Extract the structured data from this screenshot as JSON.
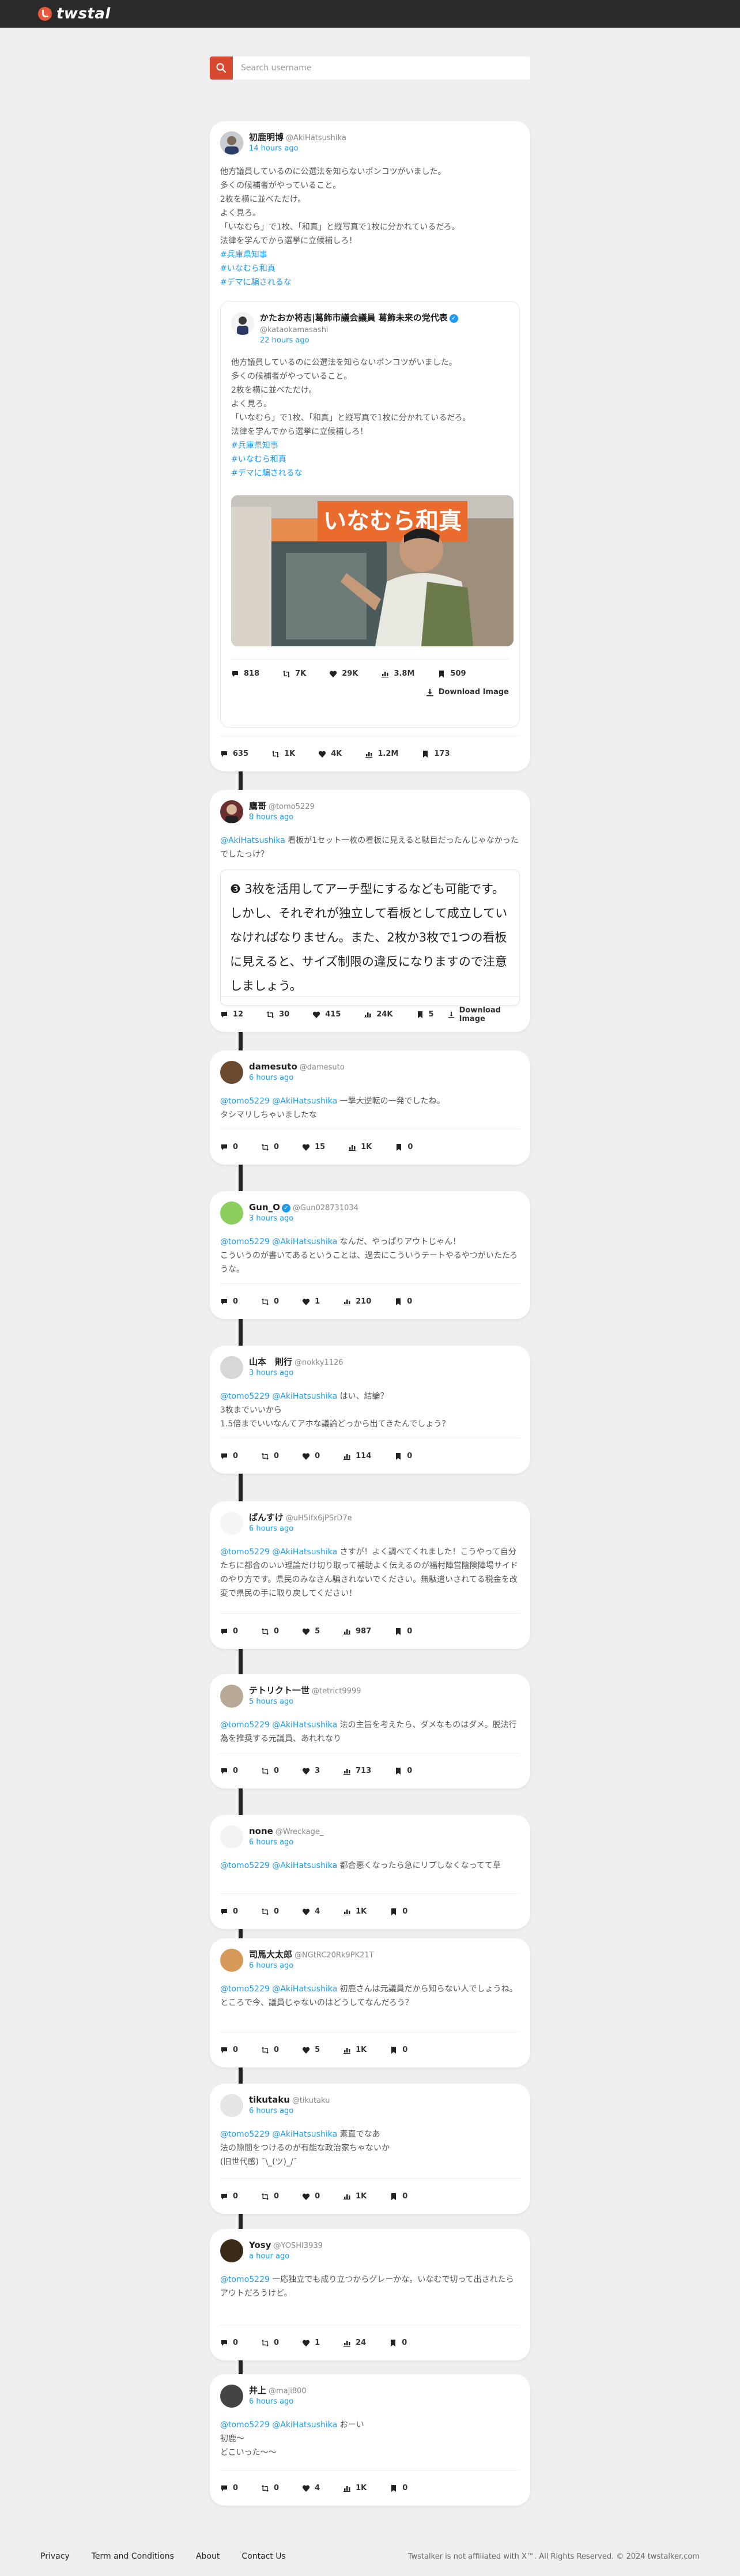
{
  "app": {
    "name": "twstal"
  },
  "search": {
    "placeholder": "Search username"
  },
  "main_post": {
    "display_name": "初鹿明博",
    "username": "@AkiHatsushika",
    "time": "14 hours ago",
    "text": "他方議員しているのに公選法を知らないポンコツがいました。\n多くの候補者がやっていること。\n2枚を横に並べただけ。\nよく見ろ。\n「いなむら」で1枚、「和真」と縦写真で1枚に分かれているだろ。\n法律を学んでから選挙に立候補しろ！",
    "hashtags": [
      "#兵庫県知事",
      "#いなむら和真",
      "#デマに騙されるな"
    ],
    "stats": {
      "replies": "635",
      "reposts": "1K",
      "likes": "4K",
      "views": "1.2M",
      "bookmarks": "173"
    },
    "quoted": {
      "display_name": "かたおか将志|葛飾市議会議員 葛飾未来の党代表",
      "username": "@kataokamasashi",
      "time": "22 hours ago",
      "text": "他方議員しているのに公選法を知らないポンコツがいました。\n多くの候補者がやっていること。\n2枚を横に並べただけ。\nよく見ろ。\n「いなむら」で1枚、「和真」と縦写真で1枚に分かれているだろ。\n法律を学んでから選挙に立候補しろ！",
      "hashtags": [
        "#兵庫県知事",
        "#いなむら和真",
        "#デマに騙されるな"
      ],
      "photo_sign_text": "いなむら和真",
      "stats": {
        "replies": "818",
        "reposts": "7K",
        "likes": "29K",
        "views": "3.8M",
        "bookmarks": "509"
      },
      "download_label": "Download Image"
    }
  },
  "replies": [
    {
      "display_name": "鷹哥",
      "username": "@tomo5229",
      "time": "8 hours ago",
      "mentions": "@AkiHatsushika",
      "text": " 看板が1セット一枚の看板に見えると駄目だったんじゃなかったでしたっけ？",
      "quote_text": "❸ 3枚を活用してアーチ型にするなども可能です。しかし、それぞれが独立して看板として成立していなければなりません。また、2枚か3枚で1つの看板に見えると、サイズ制限の違反になりますので注意しましょう。",
      "stats": {
        "replies": "12",
        "reposts": "30",
        "likes": "415",
        "views": "24K",
        "bookmarks": "5"
      },
      "download_label": "Download Image"
    },
    {
      "display_name": "damesuto",
      "username": "@damesuto",
      "time": "6 hours ago",
      "mentions": "@tomo5229 @AkiHatsushika",
      "text": " 一撃大逆転の一発でしたね。\nタシマリしちゃいましたな",
      "stats": {
        "replies": "0",
        "reposts": "0",
        "likes": "15",
        "views": "1K",
        "bookmarks": "0"
      }
    },
    {
      "display_name": "Gun_O",
      "username": "@Gun028731034",
      "time": "3 hours ago",
      "mentions": "@tomo5229 @AkiHatsushika",
      "text": " なんだ、やっぱりアウトじゃん！\nこういうのが書いてあるということは、過去にこういうテートやるやつがいたたろうな。",
      "stats": {
        "replies": "0",
        "reposts": "0",
        "likes": "1",
        "views": "210",
        "bookmarks": "0"
      }
    },
    {
      "display_name": "山本　則行",
      "username": "@nokky1126",
      "time": "3 hours ago",
      "mentions": "@tomo5229 @AkiHatsushika",
      "text": " はい、結論？\n3枚までいいから\n1.5倍までいいなんてアホな議論どっから出てきたんでしょう？",
      "stats": {
        "replies": "0",
        "reposts": "0",
        "likes": "0",
        "views": "114",
        "bookmarks": "0"
      }
    },
    {
      "display_name": "ぱんすけ",
      "username": "@uH5Ifx6jPSrD7e",
      "time": "6 hours ago",
      "mentions": "@tomo5229 @AkiHatsushika",
      "text": " さすが！よく調べてくれました！こうやって自分たちに都合のいい理論だけ切り取って補助よく伝えるのが福村陣営陰険陣場サイドのやり方です。県民のみなさん騙されないでください。無駄遣いされてる税金を改変で県民の手に取り戻してください！",
      "stats": {
        "replies": "0",
        "reposts": "0",
        "likes": "5",
        "views": "987",
        "bookmarks": "0"
      }
    },
    {
      "display_name": "テトリクト一世",
      "username": "@tetrict9999",
      "time": "5 hours ago",
      "mentions": "@tomo5229 @AkiHatsushika",
      "text": " 法の主旨を考えたら、ダメなものはダメ。脱法行為を推奨する元議員、あれれなり",
      "stats": {
        "replies": "0",
        "reposts": "0",
        "likes": "3",
        "views": "713",
        "bookmarks": "0"
      }
    },
    {
      "display_name": "none",
      "username": "@Wreckage_",
      "time": "6 hours ago",
      "mentions": "@tomo5229 @AkiHatsushika",
      "text": " 都合悪くなったら急にリプしなくなってて草",
      "stats": {
        "replies": "0",
        "reposts": "0",
        "likes": "4",
        "views": "1K",
        "bookmarks": "0"
      }
    },
    {
      "display_name": "司馬大太郎",
      "username": "@NGtRC20Rk9PK21T",
      "time": "6 hours ago",
      "mentions": "@tomo5229 @AkiHatsushika",
      "text": " 初鹿さんは元議員だから知らない人でしょうね。ところで今、議員じゃないのはどうしてなんだろう？",
      "stats": {
        "replies": "0",
        "reposts": "0",
        "likes": "5",
        "views": "1K",
        "bookmarks": "0"
      }
    },
    {
      "display_name": "tikutaku",
      "username": "@tikutaku",
      "time": "6 hours ago",
      "mentions": "@tomo5229 @AkiHatsushika",
      "text": " 素直でなあ\n法の隙間をつけるのが有能な政治家ちゃないか\n(旧世代感) ¯\\_(ツ)_/¯",
      "stats": {
        "replies": "0",
        "reposts": "0",
        "likes": "0",
        "views": "1K",
        "bookmarks": "0"
      }
    },
    {
      "display_name": "Yosy",
      "username": "@YOSHI3939",
      "time": "a hour ago",
      "mentions": "@tomo5229",
      "text": " 一応独立でも成り立つからグレーかな。いなむで切って出されたらアウトだろうけど。",
      "stats": {
        "replies": "0",
        "reposts": "0",
        "likes": "1",
        "views": "24",
        "bookmarks": "0"
      }
    },
    {
      "display_name": "井上",
      "username": "@maji800",
      "time": "6 hours ago",
      "mentions": "@tomo5229 @AkiHatsushika",
      "text": " おーい\n初鹿〜\nどこいった〜〜",
      "stats": {
        "replies": "0",
        "reposts": "0",
        "likes": "4",
        "views": "1K",
        "bookmarks": "0"
      }
    }
  ],
  "footer": {
    "links": [
      "Privacy",
      "Term and Conditions",
      "About",
      "Contact Us"
    ],
    "copyright": "Twstalker is not affiliated with X™. All Rights Reserved. © 2024 twstalker.com"
  },
  "colors": {
    "accent": "#1d9bf0",
    "brand": "#d84a2f",
    "topbar": "#2a2a2a"
  },
  "icons": [
    "search-icon",
    "reply-icon",
    "repost-icon",
    "heart-icon",
    "views-icon",
    "bookmark-icon",
    "download-icon",
    "verified-icon"
  ]
}
